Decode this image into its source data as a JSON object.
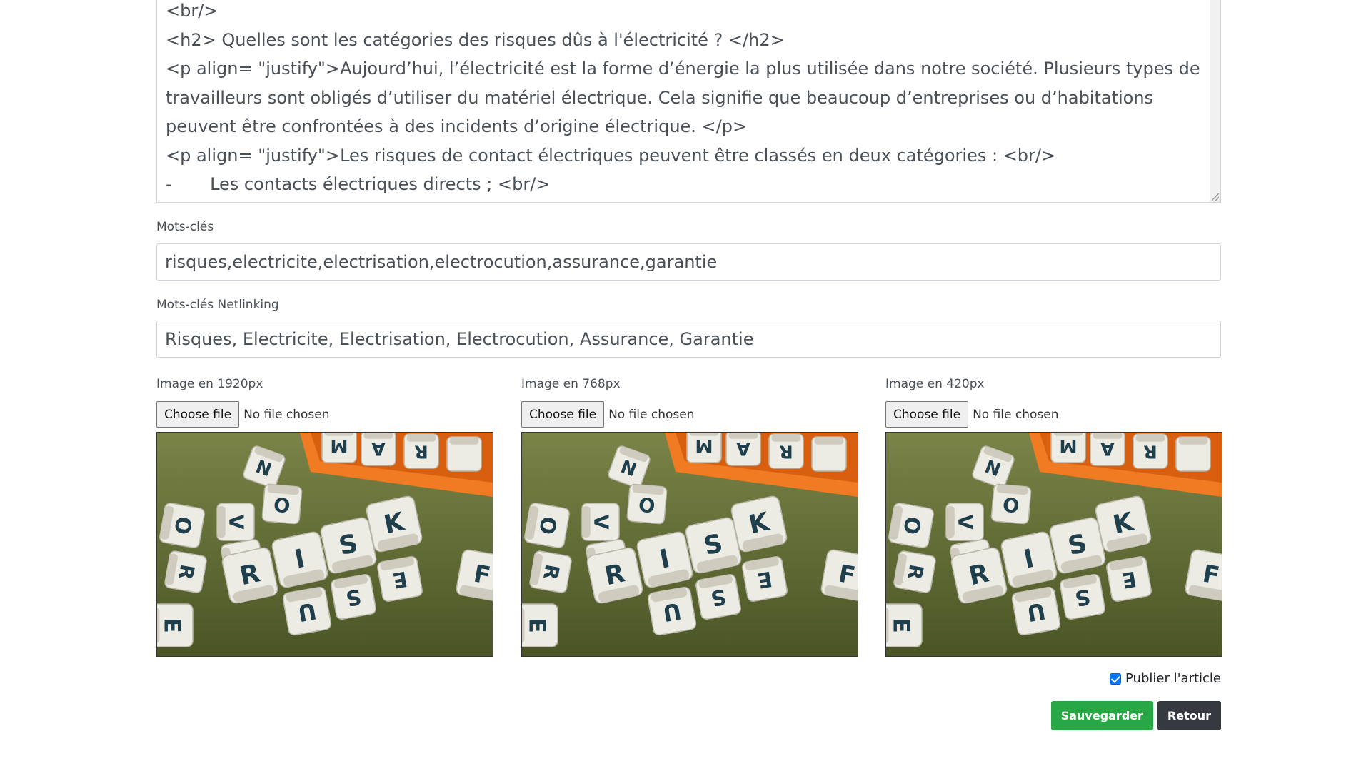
{
  "editor": {
    "lines": [
      "<br/>",
      "<h2> Quelles sont les catégories des risques dûs à l'électricité ? </h2>",
      "<p align= \"justify\">Aujourd’hui, l’électricité est la forme d’énergie la plus utilisée dans notre société. Plusieurs types de",
      "travailleurs sont obligés d’utiliser du matériel électrique. Cela signifie que beaucoup d’entreprises ou d’habitations",
      "peuvent être confrontées à des incidents d’origine électrique. </p>",
      "<p align= \"justify\">Les risques de contact électriques peuvent être classés en deux catégories : <br/>",
      "-       Les contacts électriques directs ; <br/>"
    ]
  },
  "keywords": {
    "label": "Mots-clés",
    "value": "risques,electricite,electrisation,electrocution,assurance,garantie"
  },
  "netlinking": {
    "label": "Mots-clés Netlinking",
    "value": "Risques, Electricite, Electrisation, Electrocution, Assurance, Garantie"
  },
  "images": [
    {
      "label": "Image en 1920px",
      "button": "Choose file",
      "status": "No file chosen",
      "dice_text": "RISK"
    },
    {
      "label": "Image en 768px",
      "button": "Choose file",
      "status": "No file chosen",
      "dice_text": "RISK"
    },
    {
      "label": "Image en 420px",
      "button": "Choose file",
      "status": "No file chosen",
      "dice_text": "RISK"
    }
  ],
  "publish": {
    "label": "Publier l'article",
    "checked": true
  },
  "actions": {
    "save": "Sauvegarder",
    "back": "Retour"
  },
  "colors": {
    "save": "#28a745",
    "back": "#343a40",
    "checkbox": "#0075ff"
  }
}
